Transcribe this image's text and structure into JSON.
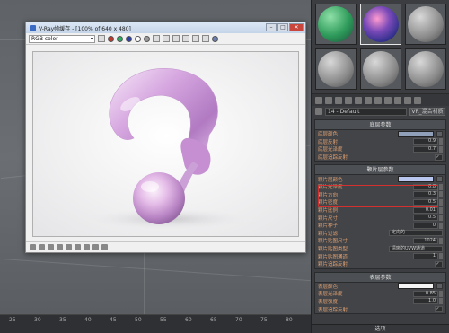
{
  "vfb": {
    "title": "V-Ray帧缓存 - [100% of 640 x 480]",
    "channel": "RGB color",
    "minimize": "–",
    "maximize": "□",
    "close": "✕"
  },
  "material": {
    "name": "14 - Default",
    "type": "VR_混合材质",
    "base_section": {
      "title": "底层参数",
      "rows": [
        {
          "label": "底层颜色",
          "kind": "swatch",
          "color": "#8fa0b8"
        },
        {
          "label": "底层反射",
          "kind": "value",
          "value": "0.9"
        },
        {
          "label": "底层光泽度",
          "kind": "value",
          "value": "0.7"
        },
        {
          "label": "底层追踪反射",
          "kind": "check",
          "value": "✓"
        }
      ]
    },
    "flake_section": {
      "title": "颗片层参数",
      "rows": [
        {
          "label": "颗片层颜色",
          "kind": "swatch",
          "color": "#b8c6f0"
        },
        {
          "label": "颗片光泽度",
          "kind": "value",
          "value": "0.8"
        },
        {
          "label": "颗片方向",
          "kind": "value",
          "value": "0.3"
        },
        {
          "label": "颗片密度",
          "kind": "value",
          "value": "0.5"
        },
        {
          "label": "颗片比例",
          "kind": "value",
          "value": "0.01"
        },
        {
          "label": "颗片尺寸",
          "kind": "value",
          "value": "0.5"
        },
        {
          "label": "颗片种子",
          "kind": "value",
          "value": "0"
        },
        {
          "label": "颗片过滤",
          "kind": "select",
          "value": "定向的"
        },
        {
          "label": "颗片贴图尺寸",
          "kind": "value",
          "value": "1024"
        },
        {
          "label": "颗片贴图类型",
          "kind": "select",
          "value": "清晰的UVW通道"
        },
        {
          "label": "颗片贴图通道",
          "kind": "value",
          "value": "1"
        },
        {
          "label": "颗片追踪反射",
          "kind": "check",
          "value": "✓"
        }
      ]
    },
    "coat_section": {
      "title": "表层参数",
      "rows": [
        {
          "label": "表层颜色",
          "kind": "swatch",
          "color": "#f4f4f4"
        },
        {
          "label": "表层光泽度",
          "kind": "value",
          "value": "0.85"
        },
        {
          "label": "表层强度",
          "kind": "value",
          "value": "1.0"
        },
        {
          "label": "表层追踪反射",
          "kind": "check",
          "value": "✓"
        }
      ]
    },
    "footer": "选项"
  },
  "ruler": {
    "ticks": [
      "25",
      "30",
      "35",
      "40",
      "45",
      "50",
      "55",
      "60",
      "65",
      "70",
      "75",
      "80"
    ]
  },
  "colors": {
    "accent_highlight": "#d43030",
    "render_pink": "#c98fd3"
  }
}
